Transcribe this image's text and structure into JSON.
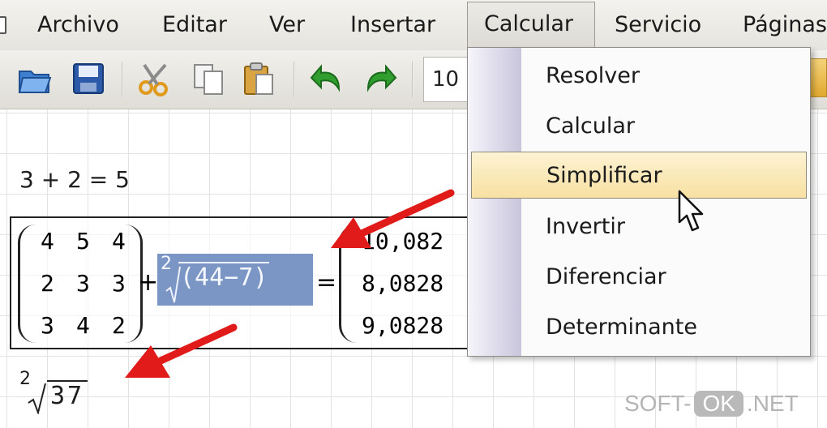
{
  "menubar": {
    "items": [
      "Archivo",
      "Editar",
      "Ver",
      "Insertar",
      "Calcular",
      "Servicio",
      "Páginas"
    ]
  },
  "toolbar": {
    "font_size": "10",
    "buttons": [
      "open-icon",
      "save-icon",
      "cut-icon",
      "copy-icon",
      "paste-icon",
      "undo-icon",
      "redo-icon"
    ]
  },
  "sheet": {
    "simple_expr": "3 + 2 = 5",
    "matrix": [
      [
        "4",
        "5",
        "4"
      ],
      [
        "2",
        "3",
        "3"
      ],
      [
        "3",
        "4",
        "2"
      ]
    ],
    "plus": "+",
    "equals": "=",
    "root_index": "2",
    "root_body": "(44−7)",
    "result_rows": [
      "10,082",
      "8,0828",
      "9,0828"
    ],
    "root_result_index": "2",
    "root_result_body": "37"
  },
  "dropdown": {
    "items": [
      "Resolver",
      "Calcular",
      "Simplificar",
      "Invertir",
      "Diferenciar",
      "Determinante"
    ],
    "hovered_index": 2
  },
  "watermark": {
    "left": "SOFT-",
    "ok": "OK",
    "right": ".NET"
  },
  "colors": {
    "selection": "#7b95c5",
    "arrow": "#e11a1a",
    "hover": "#f7e0a2"
  }
}
